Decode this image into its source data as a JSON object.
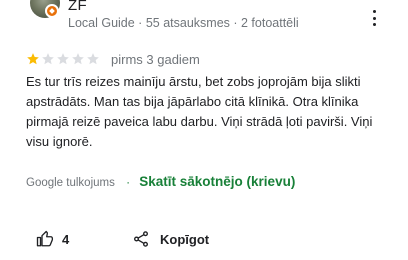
{
  "reviewer": {
    "name": "ZF",
    "meta": "Local Guide · 55 atsauksmes · 2 fotoattēli"
  },
  "rating": {
    "stars": 1,
    "max": 5,
    "date": "pirms 3 gadiem"
  },
  "review": {
    "text": "Es tur trīs reizes mainīju ārstu, bet zobs joprojām bija slikti apstrādāts. Man tas bija jāpārlabo citā klīnikā. Otra klīnika pirmajā reizē paveica labu darbu. Viņi strādā ļoti pavirši. Viņi visu ignorē."
  },
  "translation": {
    "label": "Google tulkojums",
    "separator": "·",
    "original_link": "Skatīt sākotnējo (krievu)"
  },
  "actions": {
    "like_count": "4",
    "share_label": "Kopīgot"
  },
  "colors": {
    "star_filled": "#fbbc04",
    "star_empty": "#dadce0",
    "link": "#188038",
    "badge": "#e8710a"
  },
  "icons": [
    "more-vert-icon",
    "star-icon",
    "thumb-up-icon",
    "share-icon",
    "local-guide-badge-icon"
  ]
}
